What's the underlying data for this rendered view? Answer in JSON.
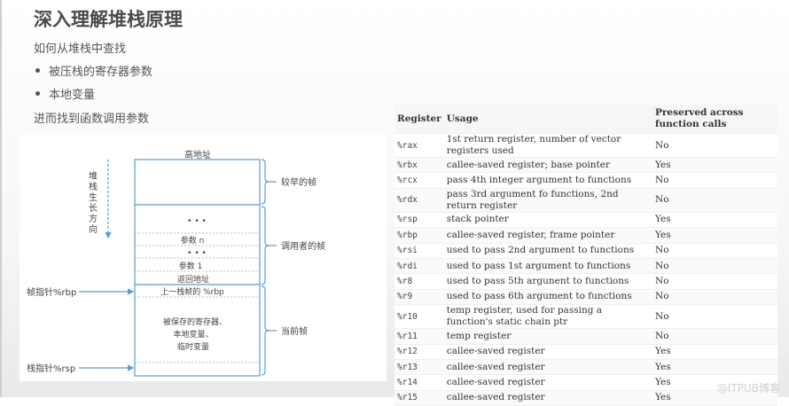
{
  "slide": {
    "title": "深入理解堆栈原理",
    "lines": [
      "如何从堆栈中查找",
      "被压栈的寄存器参数",
      "本地变量",
      "进而找到函数调用参数"
    ]
  },
  "diagram": {
    "high_address": "高地址",
    "growth_direction": [
      "堆",
      "栈",
      "生",
      "长",
      "方",
      "向"
    ],
    "slots": {
      "dots1": "• • •",
      "param_n": "参数 n",
      "dots2": "• • •",
      "param_1": "参数 1",
      "return_addr": "返回地址",
      "prev_rbp": "上一栈帧的 %rbp",
      "saved1": "被保存的寄存器、",
      "saved2": "本地变量、",
      "saved3": "临时变量"
    },
    "braces": {
      "earlier": "较早的帧",
      "caller": "调用者的帧",
      "current": "当前帧"
    },
    "pointers": {
      "rbp": "帧指针%rbp",
      "rsp": "栈指针%rsp"
    },
    "line_color": "#5b9bd5"
  },
  "table": {
    "headers": [
      "Register",
      "Usage",
      "Preserved across function calls"
    ],
    "rows": [
      [
        "%rax",
        "1st return register, number of vector registers used",
        "No"
      ],
      [
        "%rbx",
        "callee-saved register; base pointer",
        "Yes"
      ],
      [
        "%rcx",
        "pass 4th integer argument to functions",
        "No"
      ],
      [
        "%rdx",
        "pass 3rd argument fo functions, 2nd return register",
        "No"
      ],
      [
        "%rsp",
        "stack pointer",
        "Yes"
      ],
      [
        "%rbp",
        "callee-saved register, frame pointer",
        "Yes"
      ],
      [
        "%rsi",
        "used to pass 2nd argument to functions",
        "No"
      ],
      [
        "%rdi",
        "used to pass 1st argument to functions",
        "No"
      ],
      [
        "%r8",
        "used to pass 5th argunent to functions",
        "No"
      ],
      [
        "%r9",
        "used to pass 6th argument to functions",
        "No"
      ],
      [
        "%r10",
        "temp register, used for passing a function's static chain ptr",
        "No"
      ],
      [
        "%r11",
        "temp register",
        "No"
      ],
      [
        "%r12",
        "callee-saved register",
        "Yes"
      ],
      [
        "%r13",
        "callee-saved register",
        "Yes"
      ],
      [
        "%r14",
        "callee-saved register",
        "Yes"
      ],
      [
        "%r15",
        "callee-saved register",
        "Yes"
      ]
    ]
  },
  "watermark": "@ITPUB博客"
}
